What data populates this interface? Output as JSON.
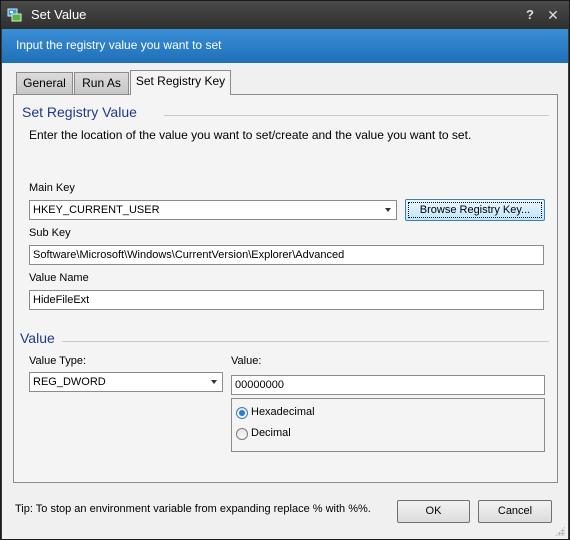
{
  "window": {
    "title": "Set Value",
    "help_glyph": "?",
    "close_glyph": "✕"
  },
  "banner": {
    "text": "Input the registry value you want to set"
  },
  "tabs": [
    {
      "label": "General",
      "active": false
    },
    {
      "label": "Run As",
      "active": false
    },
    {
      "label": "Set Registry Key",
      "active": true
    }
  ],
  "registry_group": {
    "title": "Set Registry Value",
    "instructions": "Enter the location of the value you want to set/create and the value you want to set.",
    "main_key_label": "Main Key",
    "main_key_value": "HKEY_CURRENT_USER",
    "browse_label": "Browse Registry Key...",
    "sub_key_label": "Sub Key",
    "sub_key_value": "Software\\Microsoft\\Windows\\CurrentVersion\\Explorer\\Advanced",
    "value_name_label": "Value Name",
    "value_name_value": "HideFileExt"
  },
  "value_group": {
    "title": "Value",
    "value_type_label": "Value Type:",
    "value_type_selected": "REG_DWORD",
    "value_label": "Value:",
    "value_value": "00000000",
    "radio_options": [
      {
        "label": "Hexadecimal",
        "checked": true
      },
      {
        "label": "Decimal",
        "checked": false
      }
    ]
  },
  "footer": {
    "tip": "Tip: To stop an environment variable from expanding replace % with %%.",
    "ok_label": "OK",
    "cancel_label": "Cancel"
  },
  "colors": {
    "banner": "#2a80c8",
    "group_title": "#1e3a8a",
    "radio_accent": "#2a7ad6"
  }
}
